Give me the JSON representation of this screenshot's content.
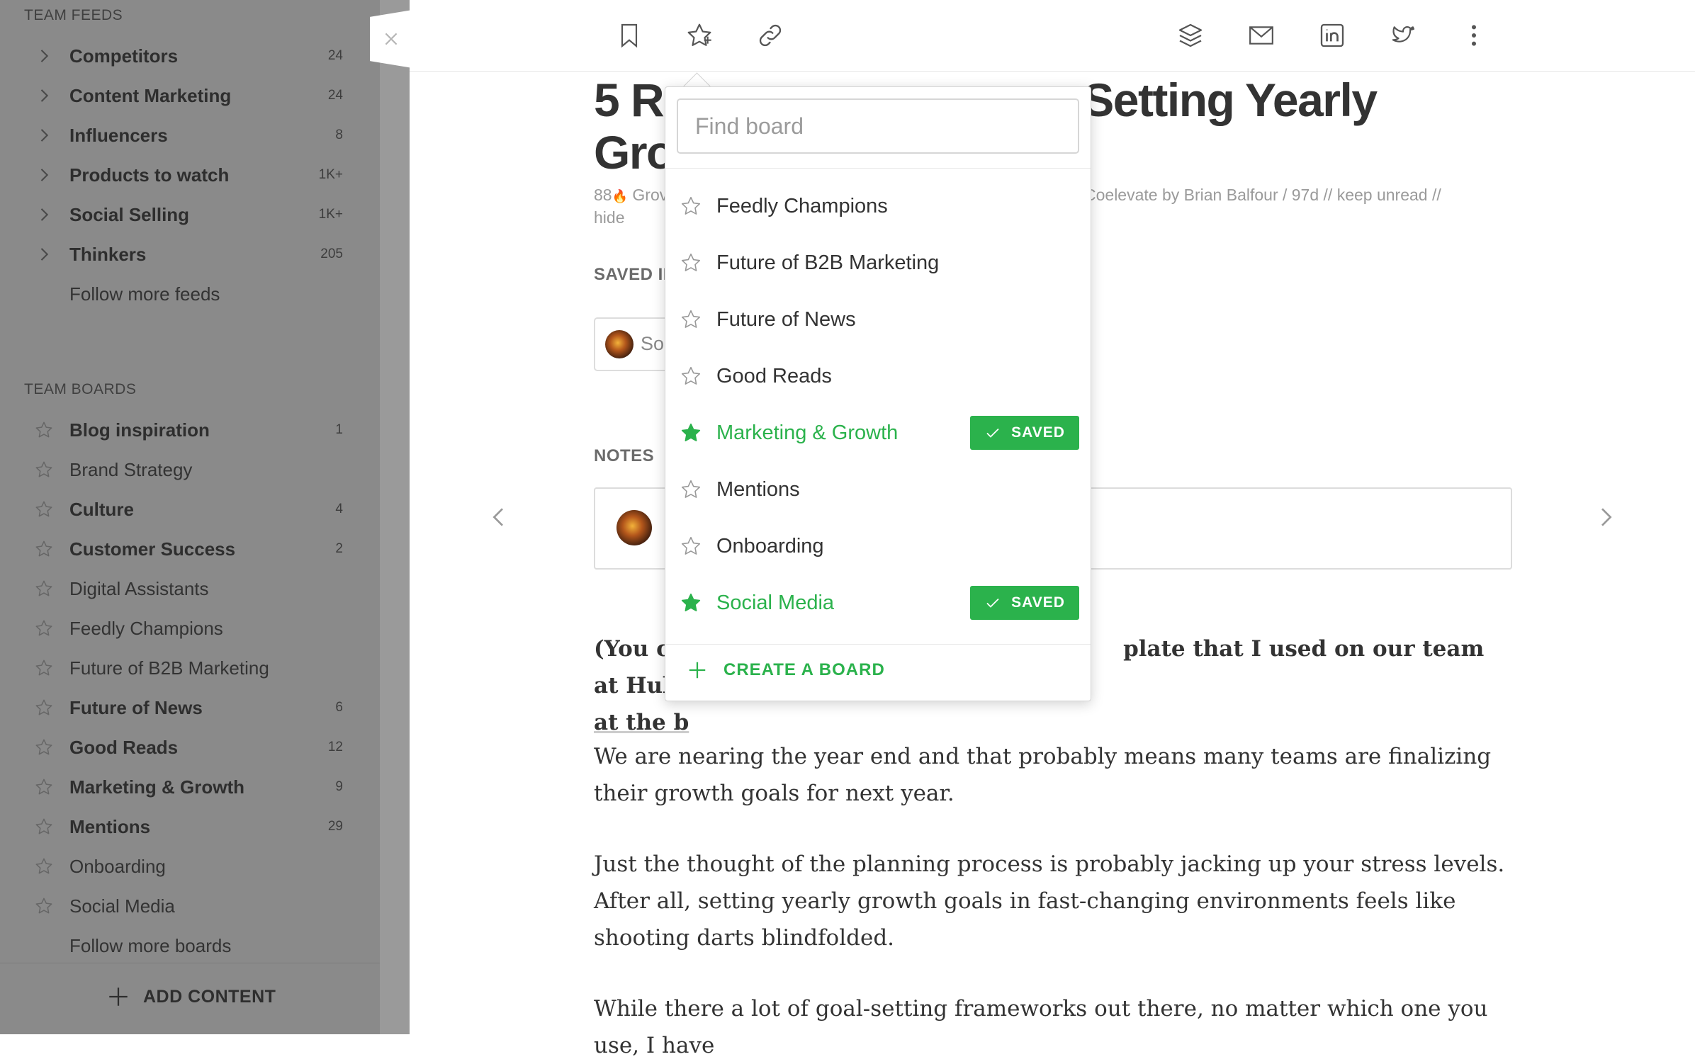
{
  "sidebar": {
    "team_feeds_title": "TEAM FEEDS",
    "feeds": [
      {
        "label": "Competitors",
        "count": "24"
      },
      {
        "label": "Content Marketing",
        "count": "24"
      },
      {
        "label": "Influencers",
        "count": "8"
      },
      {
        "label": "Products to watch",
        "count": "1K+"
      },
      {
        "label": "Social Selling",
        "count": "1K+"
      },
      {
        "label": "Thinkers",
        "count": "205"
      }
    ],
    "follow_more_feeds": "Follow more feeds",
    "team_boards_title": "TEAM BOARDS",
    "boards": [
      {
        "label": "Blog inspiration",
        "count": "1",
        "bold": true
      },
      {
        "label": "Brand Strategy",
        "count": "",
        "bold": false
      },
      {
        "label": "Culture",
        "count": "4",
        "bold": true
      },
      {
        "label": "Customer Success",
        "count": "2",
        "bold": true
      },
      {
        "label": "Digital Assistants",
        "count": "",
        "bold": false
      },
      {
        "label": "Feedly Champions",
        "count": "",
        "bold": false
      },
      {
        "label": "Future of B2B Marketing",
        "count": "",
        "bold": false
      },
      {
        "label": "Future of News",
        "count": "6",
        "bold": true
      },
      {
        "label": "Good Reads",
        "count": "12",
        "bold": true
      },
      {
        "label": "Marketing & Growth",
        "count": "9",
        "bold": true
      },
      {
        "label": "Mentions",
        "count": "29",
        "bold": true
      },
      {
        "label": "Onboarding",
        "count": "",
        "bold": false
      },
      {
        "label": "Social Media",
        "count": "",
        "bold": false
      }
    ],
    "follow_more_boards": "Follow more boards",
    "add_content": "ADD CONTENT"
  },
  "toolbar": {
    "left_icons": [
      "bookmark-icon",
      "star-icon",
      "link-icon"
    ],
    "right_icons": [
      "layers-icon",
      "mail-icon",
      "linkedin-icon",
      "twitter-icon",
      "more-vertical-icon"
    ]
  },
  "article": {
    "title_left": "5 R",
    "title_right": "Setting Yearly",
    "title_line2": "Gro",
    "meta_left": "88",
    "meta_source": "Grov",
    "meta_right": "Coelevate by Brian Balfour  /  97d  //  keep unread  //",
    "meta_hide": "hide",
    "saved_in_label": "SAVED II",
    "saved_chip_text": "So",
    "notes_label": "NOTES",
    "intro_a": "(You ca",
    "intro_b": "plate that I used on our team at HubSpot",
    "intro_c": "at the b",
    "para1": "We are nearing the year end and that probably means many teams are finalizing their growth goals for next year.",
    "para2": "Just the thought of the planning process is probably jacking up your stress levels. After all, setting yearly growth goals in fast-changing environments feels like shooting darts blindfolded.",
    "para3": "While there a lot of goal-setting frameworks out there, no matter which one you use, I have"
  },
  "board_popup": {
    "search_placeholder": "Find board",
    "items": [
      {
        "label": "Feedly Champions",
        "saved": false
      },
      {
        "label": "Future of B2B Marketing",
        "saved": false
      },
      {
        "label": "Future of News",
        "saved": false
      },
      {
        "label": "Good Reads",
        "saved": false
      },
      {
        "label": "Marketing & Growth",
        "saved": true
      },
      {
        "label": "Mentions",
        "saved": false
      },
      {
        "label": "Onboarding",
        "saved": false
      },
      {
        "label": "Social Media",
        "saved": true
      }
    ],
    "saved_badge": "SAVED",
    "create_board": "CREATE A BOARD"
  },
  "colors": {
    "accent_green": "#2bb24c",
    "sidebar_overlay": "#8a8a8a"
  }
}
